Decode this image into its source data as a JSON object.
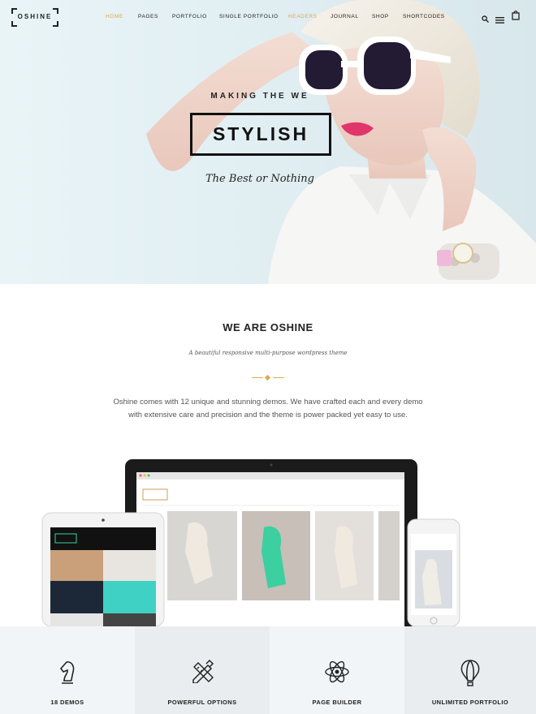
{
  "brand": {
    "logo_text": "OSHINE"
  },
  "nav": {
    "items": [
      {
        "label": "HOME",
        "state": "active"
      },
      {
        "label": "PAGES"
      },
      {
        "label": "PORTFOLIO"
      },
      {
        "label": "SINGLE PORTFOLIO"
      },
      {
        "label": "HEADERS",
        "state": "highlight"
      },
      {
        "label": "JOURNAL"
      },
      {
        "label": "SHOP"
      },
      {
        "label": "SHORTCODES"
      }
    ],
    "tools": [
      "search-icon",
      "menu-icon",
      "cart-icon"
    ]
  },
  "hero": {
    "kicker": "MAKING THE WE",
    "headline": "STYLISH",
    "subtitle": "The Best or Nothing"
  },
  "intro": {
    "title": "WE ARE OSHINE",
    "tagline": "A beautiful responsive multi-purpose wordpress theme",
    "body_line1": "Oshine comes with 12 unique and stunning demos. We have crafted each and every demo",
    "body_line2": "with extensive care and precision and the theme is power packed yet easy to use."
  },
  "features": [
    {
      "label": "18 DEMOS",
      "icon": "chess-knight-icon"
    },
    {
      "label": "POWERFUL OPTIONS",
      "icon": "pencil-ruler-icon"
    },
    {
      "label": "PAGE BUILDER",
      "icon": "atom-icon"
    },
    {
      "label": "UNLIMITED PORTFOLIO",
      "icon": "hot-air-balloon-icon"
    }
  ],
  "colors": {
    "accent": "#e0a84a",
    "text": "#222222",
    "feature_bg_light": "#f2f5f7",
    "feature_bg_dark": "#e9edf0"
  }
}
